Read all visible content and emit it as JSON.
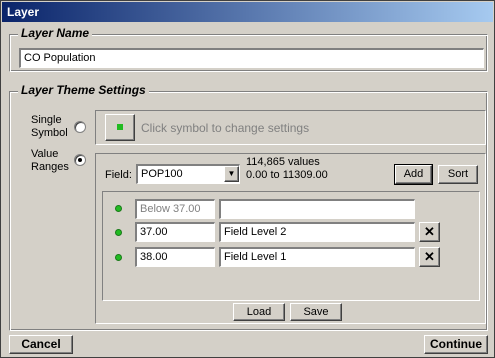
{
  "window": {
    "title": "Layer"
  },
  "layer_name": {
    "group_title": "Layer Name",
    "value": "CO Population"
  },
  "theme": {
    "group_title": "Layer Theme Settings",
    "single_symbol_label_1": "Single",
    "single_symbol_label_2": "Symbol",
    "single_symbol_hint": "Click symbol to change settings",
    "value_ranges_label_1": "Value",
    "value_ranges_label_2": "Ranges",
    "selected": "value_ranges"
  },
  "ranges": {
    "field_label": "Field:",
    "field_value": "POP100",
    "count_text": "114,865 values",
    "range_text": "0.00 to 11309.00",
    "add_label": "Add",
    "sort_label": "Sort",
    "rows": [
      {
        "threshold": "Below 37.00",
        "name": "",
        "removable": false
      },
      {
        "threshold": "37.00",
        "name": "Field Level 2",
        "removable": true
      },
      {
        "threshold": "38.00",
        "name": "Field Level 1",
        "removable": true
      }
    ],
    "remove_label": "✕",
    "load_label": "Load",
    "save_label": "Save"
  },
  "footer": {
    "cancel_label": "Cancel",
    "continue_label": "Continue"
  },
  "colors": {
    "symbol_green": "#22bb22",
    "titlebar_start": "#0a246a"
  }
}
